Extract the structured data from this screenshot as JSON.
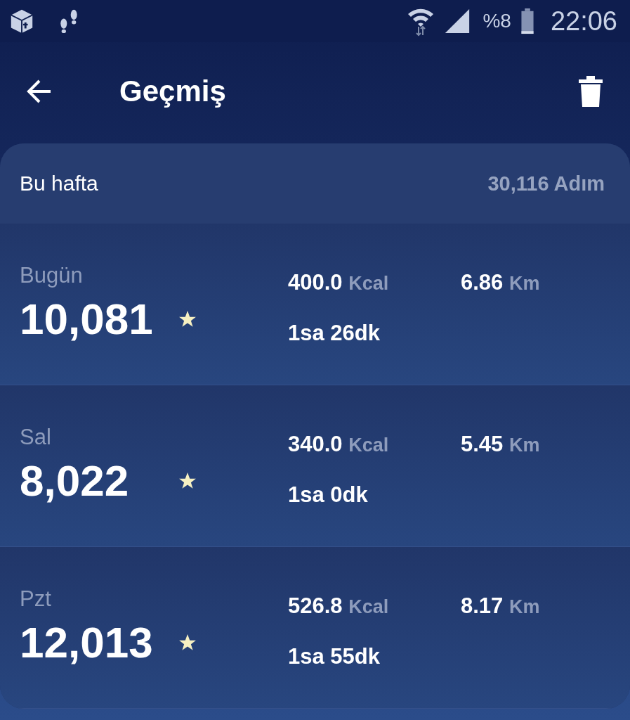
{
  "status_bar": {
    "battery": "%8",
    "time": "22:06"
  },
  "header": {
    "title": "Geçmiş"
  },
  "week": {
    "label": "Bu hafta",
    "total": "30,116 Adım"
  },
  "days": [
    {
      "day": "Bugün",
      "steps": "10,081",
      "goal_reached": true,
      "kcal": "400.0",
      "kcal_unit": "Kcal",
      "km": "6.86",
      "km_unit": "Km",
      "duration": "1sa 26dk"
    },
    {
      "day": "Sal",
      "steps": "8,022",
      "goal_reached": true,
      "kcal": "340.0",
      "kcal_unit": "Kcal",
      "km": "5.45",
      "km_unit": "Km",
      "duration": "1sa 0dk"
    },
    {
      "day": "Pzt",
      "steps": "12,013",
      "goal_reached": true,
      "kcal": "526.8",
      "kcal_unit": "Kcal",
      "km": "8.17",
      "km_unit": "Km",
      "duration": "1sa 55dk"
    }
  ]
}
